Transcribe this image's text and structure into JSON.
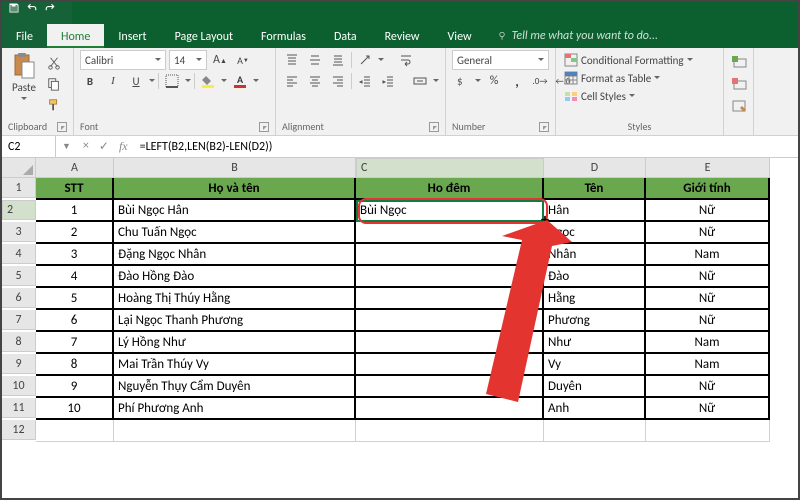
{
  "tabs": {
    "file": "File",
    "list": [
      "Home",
      "Insert",
      "Page Layout",
      "Formulas",
      "Data",
      "Review",
      "View"
    ],
    "active": "Home",
    "tell_me": "Tell me what you want to do..."
  },
  "ribbon": {
    "clipboard": {
      "paste": "Paste",
      "label": "Clipboard"
    },
    "font": {
      "name": "Calibri",
      "size": "14",
      "label": "Font",
      "bold": "B",
      "italic": "I",
      "underline": "U"
    },
    "alignment": {
      "label": "Alignment"
    },
    "number": {
      "format": "General",
      "label": "Number"
    },
    "styles": {
      "conditional": "Conditional Formatting",
      "table": "Format as Table",
      "cell": "Cell Styles",
      "label": "Styles"
    }
  },
  "formula_bar": {
    "cell_ref": "C2",
    "formula": "=LEFT(B2,LEN(B2)-LEN(D2))"
  },
  "columns": [
    "A",
    "B",
    "C",
    "D",
    "E"
  ],
  "headers": {
    "A": "STT",
    "B": "Họ và tên",
    "C": "Ho đêm",
    "D": "Tên",
    "E": "Giới tính"
  },
  "rows": [
    {
      "n": "1",
      "A": "1",
      "B": "Bùi Ngọc Hân",
      "C": "Bùi Ngọc",
      "D": "Hân",
      "E": "Nữ"
    },
    {
      "n": "2",
      "A": "2",
      "B": "Chu Tuấn Ngọc",
      "C": "",
      "D": "Ngọc",
      "E": "Nữ"
    },
    {
      "n": "3",
      "A": "3",
      "B": "Đặng Ngọc Nhân",
      "C": "",
      "D": "Nhân",
      "E": "Nam"
    },
    {
      "n": "4",
      "A": "4",
      "B": "Đào Hồng Đào",
      "C": "",
      "D": "Đào",
      "E": "Nữ"
    },
    {
      "n": "5",
      "A": "5",
      "B": "Hoàng Thị Thúy Hằng",
      "C": "",
      "D": "Hằng",
      "E": "Nữ"
    },
    {
      "n": "6",
      "A": "6",
      "B": "Lại Ngọc Thanh Phương",
      "C": "",
      "D": "Phương",
      "E": "Nữ"
    },
    {
      "n": "7",
      "A": "7",
      "B": "Lý Hồng Như",
      "C": "",
      "D": "Như",
      "E": "Nam"
    },
    {
      "n": "8",
      "A": "8",
      "B": "Mai Trần Thúy Vy",
      "C": "",
      "D": "Vy",
      "E": "Nam"
    },
    {
      "n": "9",
      "A": "9",
      "B": "Nguyễn Thụy Cẩm Duyên",
      "C": "",
      "D": "Duyên",
      "E": "Nữ"
    },
    {
      "n": "10",
      "A": "10",
      "B": "Phí Phương Anh",
      "C": "",
      "D": "Anh",
      "E": "Nữ"
    }
  ],
  "after_rows": [
    "12"
  ]
}
